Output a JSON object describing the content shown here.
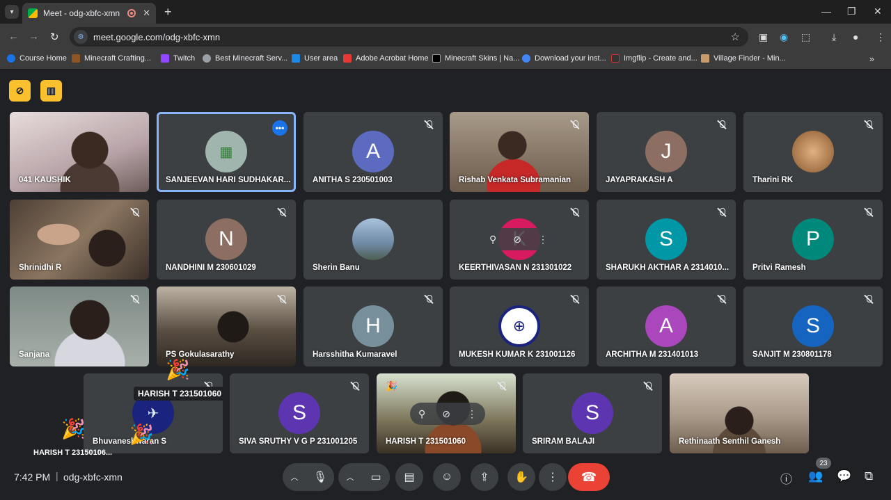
{
  "browser": {
    "tab_title": "Meet - odg-xbfc-xmn",
    "tab_close": "✕",
    "new_tab": "+",
    "url": "meet.google.com/odg-xbfc-xmn",
    "bookmarks": [
      {
        "label": "Course Home",
        "color": "#1a73e8"
      },
      {
        "label": "Minecraft Crafting...",
        "color": "#8d5524"
      },
      {
        "label": "Twitch",
        "color": "#9146ff"
      },
      {
        "label": "Best Minecraft Serv...",
        "color": "#9aa0a6"
      },
      {
        "label": "User area",
        "color": "#1e88e5"
      },
      {
        "label": "Adobe Acrobat Home",
        "color": "#e53935"
      },
      {
        "label": "Minecraft Skins | Na...",
        "color": "#000000"
      },
      {
        "label": "Download your inst...",
        "color": "#4285f4"
      },
      {
        "label": "Imgflip - Create and...",
        "color": "#333333"
      },
      {
        "label": "Village Finder - Min...",
        "color": "#c89b6b"
      }
    ]
  },
  "participants_row1": [
    {
      "name": "041 KAUSHIK",
      "type": "video",
      "bg": "#c9b8b6"
    },
    {
      "name": "SANJEEVAN HARI SUDHAKAR...",
      "type": "image",
      "bg": "#9fb5ad",
      "selected": true
    },
    {
      "name": "ANITHA S 230501003",
      "type": "avatar",
      "letter": "A",
      "color": "#5c6bc0"
    },
    {
      "name": "Rishab Venkata Subramanian",
      "type": "video",
      "bg": "#8a7a6a"
    },
    {
      "name": "JAYAPRAKASH A",
      "type": "avatar",
      "letter": "J",
      "color": "#8d6e63"
    },
    {
      "name": "Tharini RK",
      "type": "image",
      "bg": "#c98b5a"
    }
  ],
  "participants_row2": [
    {
      "name": "Shrinidhi R",
      "type": "video",
      "bg": "#6b5a4e"
    },
    {
      "name": "NANDHINI M 230601029",
      "type": "avatar",
      "letter": "N",
      "color": "#8d6e63"
    },
    {
      "name": "Sherin Banu",
      "type": "image",
      "bg": "#8fa3b8"
    },
    {
      "name": "KEERTHIVASAN N 231301022",
      "type": "avatar",
      "letter": "K",
      "color": "#d81b60"
    },
    {
      "name": "SHARUKH AKTHAR A 2314010...",
      "type": "avatar",
      "letter": "S",
      "color": "#0097a7"
    },
    {
      "name": "Pritvi Ramesh",
      "type": "avatar",
      "letter": "P",
      "color": "#00897b"
    }
  ],
  "participants_row3": [
    {
      "name": "Sanjana",
      "type": "video",
      "bg": "#8a9590"
    },
    {
      "name": "PS Gokulasarathy",
      "type": "video",
      "bg": "#6a5e52"
    },
    {
      "name": "Harsshitha Kumaravel",
      "type": "avatar",
      "letter": "H",
      "color": "#78909c"
    },
    {
      "name": "MUKESH KUMAR K 231001126",
      "type": "image",
      "bg": "#ffffff"
    },
    {
      "name": "ARCHITHA M 231401013",
      "type": "avatar",
      "letter": "A",
      "color": "#ab47bc"
    },
    {
      "name": "SANJIT M 230801178",
      "type": "avatar",
      "letter": "S",
      "color": "#1565c0"
    }
  ],
  "participants_row4": [
    {
      "name": "Bhuvaneshwaran S",
      "type": "image",
      "bg": "#1a237e"
    },
    {
      "name": "SIVA SRUTHY V G P 231001205",
      "type": "avatar",
      "letter": "S",
      "color": "#5e35b1"
    },
    {
      "name": "HARISH T 231501060",
      "type": "video",
      "bg": "#5d5a4a"
    },
    {
      "name": "SRIRAM BALAJI",
      "type": "avatar",
      "letter": "S",
      "color": "#5e35b1"
    },
    {
      "name": "Rethinaath Senthil Ganesh",
      "type": "video",
      "bg": "#b8a99a"
    }
  ],
  "tooltip": "HARISH T 231501060",
  "tooltip_partial": "HARISH T 23150106...",
  "meeting": {
    "time": "7:42 PM",
    "separator": "|",
    "code": "odg-xbfc-xmn",
    "participant_count": "23"
  },
  "colors": {
    "meet_bg": "#202124",
    "tile_bg": "#3c4043",
    "hangup": "#ea4335",
    "highlight_yellow": "#fbc02d",
    "selected_border": "#8ab4f8"
  }
}
